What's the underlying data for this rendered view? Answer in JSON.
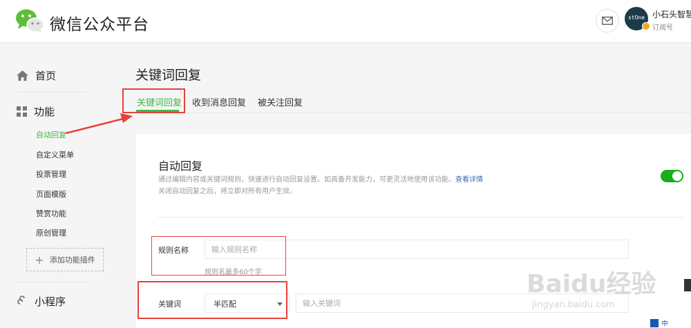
{
  "header": {
    "brand": "微信公众平台",
    "account_name": "小石头智慧",
    "account_type": "订阅号",
    "avatar_text": "stOne"
  },
  "sidebar": {
    "home": "首页",
    "features": "功能",
    "sub_items": [
      "自动回复",
      "自定义菜单",
      "投票管理",
      "页面模版",
      "赞赏功能",
      "原创管理"
    ],
    "add_plugin": "添加功能插件",
    "mini_program": "小程序"
  },
  "main": {
    "title": "关键词回复",
    "tabs": [
      "关键词回复",
      "收到消息回复",
      "被关注回复"
    ],
    "card": {
      "title": "自动回复",
      "desc": "通过编辑内容或关键词规则，快速进行自动回复设置。如具备开发能力，可更灵活地使用该功能。",
      "desc_link": "查看详情",
      "desc2": "关闭自动回复之后，将立即对所有用户生效。"
    },
    "rule_name": {
      "label": "规则名称",
      "placeholder": "输入规则名称",
      "hint": "规则名最多60个字"
    },
    "keyword": {
      "label": "关键词",
      "match_mode": "半匹配",
      "placeholder": "输入关键词"
    }
  },
  "watermark": {
    "main": "Baidu经验",
    "sub": "jingyan.baidu.com"
  },
  "ime": {
    "label": "中"
  },
  "colors": {
    "accent": "#44b549",
    "toggle": "#1aad19",
    "annotation": "#e8403b",
    "link": "#3c6bb5"
  }
}
